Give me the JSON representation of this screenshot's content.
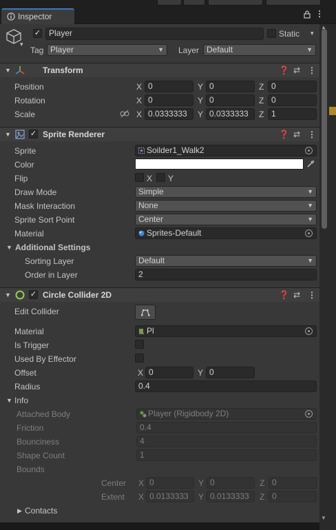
{
  "tab": {
    "title": "Inspector"
  },
  "object": {
    "name": "Player",
    "static_label": "Static",
    "tag_label": "Tag",
    "tag_value": "Player",
    "layer_label": "Layer",
    "layer_value": "Default"
  },
  "transform": {
    "title": "Transform",
    "position": {
      "label": "Position",
      "x": "0",
      "y": "0",
      "z": "0"
    },
    "rotation": {
      "label": "Rotation",
      "x": "0",
      "y": "0",
      "z": "0"
    },
    "scale": {
      "label": "Scale",
      "x": "0.0333333",
      "y": "0.0333333",
      "z": "1"
    }
  },
  "sprite_renderer": {
    "title": "Sprite Renderer",
    "sprite_label": "Sprite",
    "sprite_value": "Soilder1_Walk2",
    "color_label": "Color",
    "color_value": "#ffffff",
    "flip_label": "Flip",
    "flip_x": "X",
    "flip_y": "Y",
    "draw_mode_label": "Draw Mode",
    "draw_mode_value": "Simple",
    "mask_label": "Mask Interaction",
    "mask_value": "None",
    "sort_point_label": "Sprite Sort Point",
    "sort_point_value": "Center",
    "material_label": "Material",
    "material_value": "Sprites-Default",
    "additional_label": "Additional Settings",
    "sorting_layer_label": "Sorting Layer",
    "sorting_layer_value": "Default",
    "order_label": "Order in Layer",
    "order_value": "2"
  },
  "collider": {
    "title": "Circle Collider 2D",
    "edit_label": "Edit Collider",
    "material_label": "Material",
    "material_value": "Pl",
    "trigger_label": "Is Trigger",
    "effector_label": "Used By Effector",
    "offset_label": "Offset",
    "offset_x": "0",
    "offset_y": "0",
    "radius_label": "Radius",
    "radius_value": "0.4",
    "info_label": "Info",
    "attached_label": "Attached Body",
    "attached_value": "Player (Rigidbody 2D)",
    "friction_label": "Friction",
    "friction_value": "0.4",
    "bounciness_label": "Bounciness",
    "bounciness_value": "4",
    "shape_count_label": "Shape Count",
    "shape_count_value": "1",
    "bounds_label": "Bounds",
    "center_label": "Center",
    "center_x": "0",
    "center_y": "0",
    "center_z": "0",
    "extent_label": "Extent",
    "extent_x": "0.0133333",
    "extent_y": "0.0133333",
    "extent_z": "0",
    "contacts_label": "Contacts"
  },
  "axes": {
    "x": "X",
    "y": "Y",
    "z": "Z"
  },
  "colors": {
    "accent": "#3a79bb",
    "panel": "#383838",
    "field": "#2a2a2a",
    "collider_icon": "#8fd14f"
  }
}
